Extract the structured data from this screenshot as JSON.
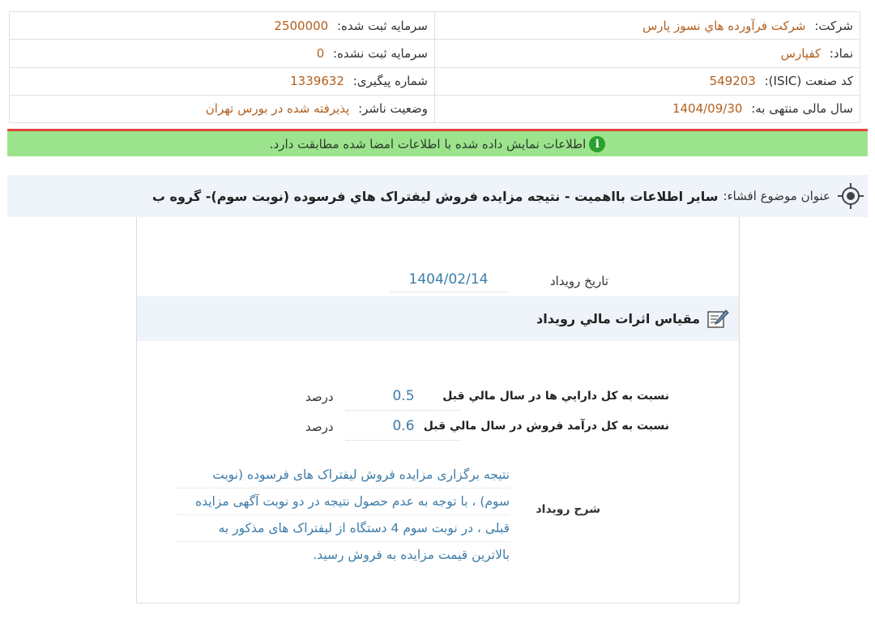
{
  "info": {
    "company_label": "شرکت:",
    "company_value": "شرکت فرآورده هاي نسوز پارس",
    "registered_capital_label": "سرمایه ثبت شده:",
    "registered_capital_value": "2500000",
    "symbol_label": "نماد:",
    "symbol_value": "کفپارس",
    "unregistered_capital_label": "سرمایه ثبت نشده:",
    "unregistered_capital_value": "0",
    "isic_label": "کد صنعت (ISIC):",
    "isic_value": "549203",
    "tracking_label": "شماره پیگیری:",
    "tracking_value": "1339632",
    "fiscal_year_label": "سال مالی منتهی به:",
    "fiscal_year_value": "1404/09/30",
    "publisher_status_label": "وضعیت ناشر:",
    "publisher_status_value": "پذیرفته شده در بورس تهران"
  },
  "success_message": "اطلاعات نمایش داده شده با اطلاعات امضا شده مطابقت دارد.",
  "subject": {
    "label": "عنوان موضوع افشاء:",
    "text": "سایر اطلاعات بااهمیت - نتیجه مزایده فروش لیفتراک هاي فرسوده (نوبت سوم)- گروه ب"
  },
  "event": {
    "date_label": "تاریخ رویداد",
    "date_value": "1404/02/14"
  },
  "financial_section_title": "مقیاس اثرات مالي رویداد",
  "metrics": [
    {
      "label": "نسبت به کل دارایي ها در سال مالي قبل",
      "value": "0.5",
      "unit": "درصد"
    },
    {
      "label": "نسبت به کل درآمد فروش در سال مالي قبل",
      "value": "0.6",
      "unit": "درصد"
    }
  ],
  "description": {
    "label": "شرح رویداد",
    "lines": [
      "نتیجه برگزاری مزایده فروش لیفتراک های فرسوده (نوبت",
      "سوم) ، با توجه به عدم حصول نتیجه در دو نوبت آگهی مزایده",
      "قبلی ، در نوبت سوم 4 دستگاه از لیفتراک های مذکور به",
      "بالاترین قیمت مزایده به فروش رسید."
    ]
  },
  "colors": {
    "value_orange": "#b3601f",
    "value_blue": "#3d7ca8",
    "success_green": "#9be38c",
    "error_red": "#e0463c"
  },
  "icons": [
    "info-icon",
    "target-icon",
    "edit-document-icon"
  ]
}
